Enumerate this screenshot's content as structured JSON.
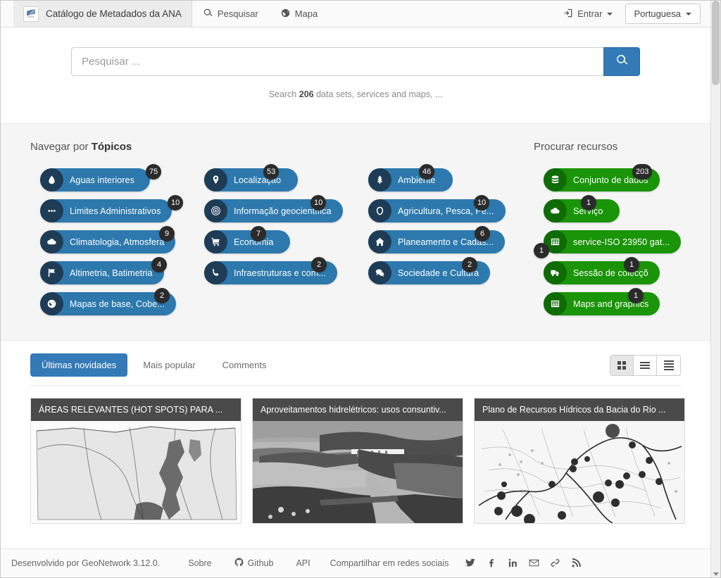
{
  "topnav": {
    "logo_alt": "ANA",
    "brand_title": "Catálogo de Metadados da ANA",
    "links": [
      {
        "label": "Pesquisar",
        "icon": "search-icon"
      },
      {
        "label": "Mapa",
        "icon": "globe-icon"
      }
    ],
    "signin_label": "Entrar",
    "language_label": "Portuguesa"
  },
  "search": {
    "placeholder": "Pesquisar ...",
    "button_icon": "search-icon",
    "hint_prefix": "Search ",
    "hint_count": "206",
    "hint_suffix": " data sets, services and maps, ..."
  },
  "browse": {
    "topics_title_prefix": "Navegar por ",
    "topics_title_strong": "Tópicos",
    "resources_title": "Procurar recursos",
    "topic_columns": [
      [
        {
          "label": "Aguas interiores",
          "count": "75",
          "icon": "water-drop-icon"
        },
        {
          "label": "Limites Administrativos",
          "count": "10",
          "icon": "dots-icon"
        },
        {
          "label": "Climatologia, Atmosfera",
          "count": "9",
          "icon": "cloud-icon"
        },
        {
          "label": "Altimetria, Batimetria",
          "count": "4",
          "icon": "flag-icon"
        },
        {
          "label": "Mapas de base, Cobe...",
          "count": "2",
          "icon": "globe-icon"
        }
      ],
      [
        {
          "label": "Localização",
          "count": "53",
          "icon": "map-pin-icon"
        },
        {
          "label": "Informação geocientífica",
          "count": "10",
          "icon": "target-icon"
        },
        {
          "label": "Economia",
          "count": "7",
          "icon": "shopping-cart-icon"
        },
        {
          "label": "Infraestruturas e com...",
          "count": "2",
          "icon": "phone-icon"
        }
      ],
      [
        {
          "label": "Ambiente",
          "count": "46",
          "icon": "tree-icon"
        },
        {
          "label": "Agricultura, Pesca, Pe...",
          "count": "10",
          "icon": "leaf-icon"
        },
        {
          "label": "Planeamento e Cadas...",
          "count": "6",
          "icon": "home-icon"
        },
        {
          "label": "Sociedade e Cultura",
          "count": "2",
          "icon": "comments-icon"
        }
      ]
    ],
    "resources": [
      {
        "label": "Conjunto de dados",
        "count": "203",
        "icon": "database-icon",
        "badge_side": "right"
      },
      {
        "label": "Serviço",
        "count": "1",
        "icon": "cloud-icon",
        "badge_side": "right"
      },
      {
        "label": "service-ISO 23950 gat...",
        "count": "1",
        "icon": "table-icon",
        "badge_side": "left"
      },
      {
        "label": "Sessão de colecçõ",
        "count": "1",
        "icon": "truck-icon",
        "badge_side": "right"
      },
      {
        "label": "Maps and graphics",
        "count": "1",
        "icon": "table-icon",
        "badge_side": "right"
      }
    ]
  },
  "latest": {
    "tabs": [
      {
        "label": "Últimas novidades",
        "active": true
      },
      {
        "label": "Mais popular",
        "active": false
      },
      {
        "label": "Comments",
        "active": false
      }
    ],
    "view_modes": [
      {
        "name": "grid-view",
        "active": true
      },
      {
        "name": "list-view",
        "active": false
      },
      {
        "name": "detail-view",
        "active": false
      }
    ],
    "cards": [
      {
        "title": "ÁREAS RELEVANTES (HOT SPOTS) PARA ...",
        "thumb": "brazil-basin-map"
      },
      {
        "title": "Aproveitamentos hidrelétricos: usos consuntiv...",
        "thumb": "dam-aerial-photo"
      },
      {
        "title": "Plano de Recursos Hídricos da Bacia do Rio ...",
        "thumb": "river-basin-points-map"
      }
    ]
  },
  "footer": {
    "developed_by": "Desenvolvido por GeoNetwork 3.12.0.",
    "links": [
      {
        "label": "Sobre",
        "icon": ""
      },
      {
        "label": "Github",
        "icon": "github-icon"
      },
      {
        "label": "API",
        "icon": ""
      }
    ],
    "share_label": "Compartilhar em redes sociais",
    "social": [
      {
        "name": "twitter-icon"
      },
      {
        "name": "facebook-icon"
      },
      {
        "name": "linkedin-icon"
      },
      {
        "name": "email-icon"
      },
      {
        "name": "link-icon"
      },
      {
        "name": "rss-icon"
      }
    ]
  },
  "colors": {
    "accent_blue": "#337ab7",
    "pill_blue": "#2d79ad",
    "pill_blue_dark": "#1f3c56",
    "pill_green": "#1a9409",
    "pill_green_dark": "#0e6b05",
    "badge_dark": "#2b2b2b",
    "card_header": "#4a4a4a",
    "browse_bg": "#f5f5f5"
  }
}
